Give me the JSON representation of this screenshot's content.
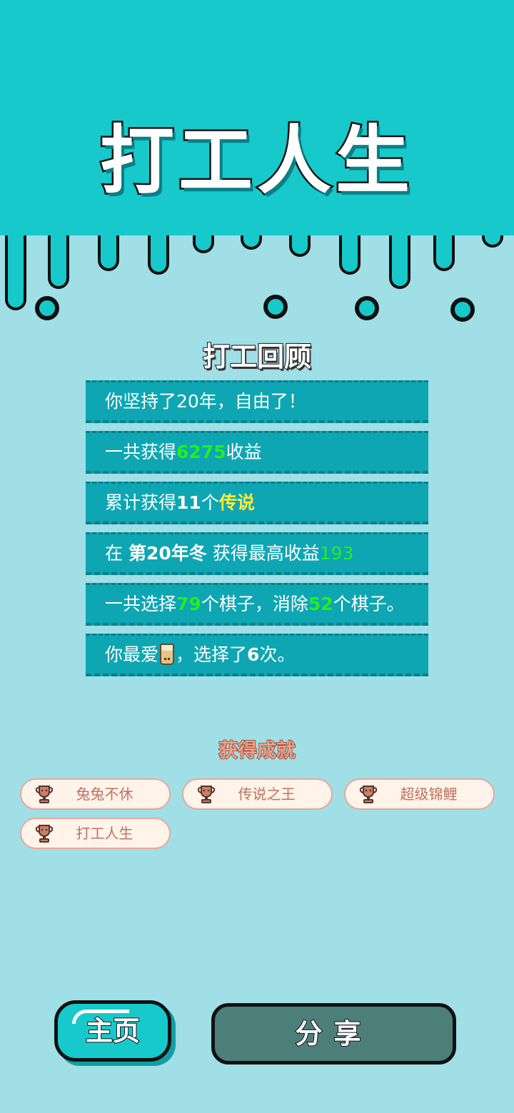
{
  "app": {
    "title": "打工人生",
    "accent_color": "#17c9cb",
    "background_color": "#a0dfe6"
  },
  "review": {
    "title": "打工回顾",
    "stats": [
      {
        "parts": [
          {
            "t": "你坚持了20年，自由了！"
          }
        ]
      },
      {
        "parts": [
          {
            "t": "一共获得"
          },
          {
            "t": "6275",
            "c": "g"
          },
          {
            "t": "收益"
          }
        ]
      },
      {
        "parts": [
          {
            "t": "累计获得"
          },
          {
            "t": "11",
            "c": "b"
          },
          {
            "t": "个"
          },
          {
            "t": "传说",
            "c": "y"
          }
        ]
      },
      {
        "parts": [
          {
            "t": "在 "
          },
          {
            "t": "第20年冬",
            "c": "b"
          },
          {
            "t": " 获得最高收益"
          },
          {
            "t": "193",
            "c": "g2"
          }
        ]
      },
      {
        "parts": [
          {
            "t": "一共选择"
          },
          {
            "t": "79",
            "c": "g"
          },
          {
            "t": "个棋子，消除"
          },
          {
            "t": "52",
            "c": "g"
          },
          {
            "t": "个棋子。"
          }
        ]
      },
      {
        "parts": [
          {
            "t": "你最爱"
          },
          {
            "icon": "milk-tea-icon"
          },
          {
            "t": "，选择了"
          },
          {
            "t": "6",
            "c": "b"
          },
          {
            "t": "次。"
          }
        ]
      }
    ]
  },
  "achievements": {
    "title": "获得成就",
    "icon": "trophy-icon",
    "items": [
      "兔兔不休",
      "传说之王",
      "超级锦鲤",
      "打工人生"
    ]
  },
  "buttons": {
    "home": "主页",
    "share": "分享"
  }
}
